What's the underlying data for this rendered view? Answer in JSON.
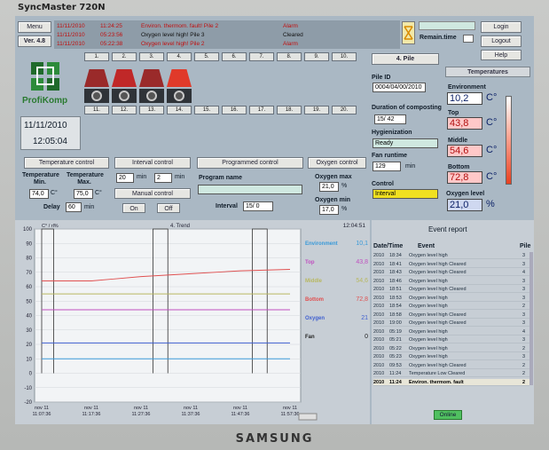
{
  "monitor": {
    "model": "SyncMaster 720N",
    "brand": "SAMSUNG"
  },
  "top": {
    "menu": "Menu",
    "version": "Ver. 4.8",
    "login": "Login",
    "logout": "Logout",
    "help": "Help",
    "remain_time": "Remain.time",
    "alarms": [
      {
        "date": "11/11/2010",
        "time": "11:24:25",
        "text": "Environ. thermom. fault! Pile 2",
        "status": "Alarm"
      },
      {
        "date": "11/11/2010",
        "time": "05:23:56",
        "text": "Oxygen level high! Pile 3",
        "status": "Cleared"
      },
      {
        "date": "11/11/2010",
        "time": "05:22:38",
        "text": "Oxygen level high! Pile 2",
        "status": "Alarm"
      }
    ]
  },
  "piles": {
    "top_numbers": [
      "1.",
      "2.",
      "3.",
      "4.",
      "5.",
      "6.",
      "7.",
      "8.",
      "9.",
      "10."
    ],
    "bottom_numbers": [
      "11.",
      "12.",
      "13.",
      "14.",
      "15.",
      "16.",
      "17.",
      "18.",
      "19.",
      "20."
    ],
    "selected": "4. Pile"
  },
  "logo": {
    "name": "ProfiKomp"
  },
  "clock": {
    "date": "11/11/2010",
    "time": "12:05:04"
  },
  "pile_info": {
    "pile_id_label": "Pile ID",
    "pile_id": "0004/04/00/2010",
    "duration_label": "Duration of composting",
    "duration": "15/  42",
    "hygienization_label": "Hygienization",
    "hygienization": "Ready",
    "fan_runtime_label": "Fan runtime",
    "fan_runtime": "129",
    "fan_runtime_unit": "min",
    "control_label": "Control",
    "control": "Interval"
  },
  "temperatures": {
    "title": "Temperatures",
    "environment_label": "Environment",
    "environment": "10,2",
    "top_label": "Top",
    "top": "43,8",
    "middle_label": "Middle",
    "middle": "54,6",
    "bottom_label": "Bottom",
    "bottom": "72,8",
    "unit": "C°",
    "oxygen_label": "Oxygen level",
    "oxygen": "21,0",
    "oxygen_unit": "%",
    "thermometer_colors": [
      "#ffffff",
      "#ffb0a0",
      "#e84020"
    ]
  },
  "controls": {
    "temperature_control": "Temperature control",
    "temp_min_label": "Temperature Min.",
    "temp_max_label": "Temperature Max.",
    "temp_min": "74,0",
    "temp_max": "75,0",
    "temp_unit": "C°",
    "delay_label": "Delay",
    "delay": "60",
    "delay_unit": "min",
    "interval_control": "Interval control",
    "interval_a": "20",
    "interval_b": "2",
    "interval_unit": "min",
    "manual_control": "Manual control",
    "on": "On",
    "off": "Off",
    "programmed_control": "Programmed control",
    "program_name_label": "Program name",
    "program_name": "",
    "interval_label": "Interval",
    "interval_value": "15/  0",
    "oxygen_control": "Oxygen control",
    "oxygen_max_label": "Oxygen max",
    "oxygen_max": "21,0",
    "oxygen_min_label": "Oxygen min",
    "oxygen_min": "17,0",
    "percent": "%"
  },
  "trend": {
    "title": "4. Trend",
    "unit_label": "C° / rl%",
    "time": "12:04:51",
    "y_ticks": [
      "100",
      "90",
      "80",
      "70",
      "60",
      "50",
      "40",
      "30",
      "20",
      "10",
      "0",
      "-10",
      "-20"
    ],
    "x_ticks": [
      {
        "date": "nov 11",
        "time": "11:07:36"
      },
      {
        "date": "nov 11",
        "time": "11:17:36"
      },
      {
        "date": "nov 11",
        "time": "11:27:36"
      },
      {
        "date": "nov 11",
        "time": "11:37:36"
      },
      {
        "date": "nov 11",
        "time": "11:47:36"
      },
      {
        "date": "nov 11",
        "time": "11:57:36"
      }
    ],
    "legend": [
      {
        "name": "Environment",
        "value": "10,1",
        "color": "#3a9ad8"
      },
      {
        "name": "Top",
        "value": "43,8",
        "color": "#c050c0"
      },
      {
        "name": "Middle",
        "value": "54,6",
        "color": "#b8b860"
      },
      {
        "name": "Bottom",
        "value": "72,8",
        "color": "#e05050"
      },
      {
        "name": "Oxygen",
        "value": "21",
        "color": "#4060d0"
      },
      {
        "name": "Fan",
        "value": "0",
        "color": "#222222"
      }
    ]
  },
  "chart_data": {
    "type": "line",
    "title": "4. Trend",
    "ylabel": "C° / rl%",
    "ylim": [
      -20,
      100
    ],
    "x": [
      "11:07:36",
      "11:17:36",
      "11:27:36",
      "11:37:36",
      "11:47:36",
      "11:57:36"
    ],
    "series": [
      {
        "name": "Environment",
        "values": [
          10,
          10,
          10,
          10,
          10,
          10
        ]
      },
      {
        "name": "Top",
        "values": [
          44,
          44,
          44,
          44,
          44,
          44
        ]
      },
      {
        "name": "Middle",
        "values": [
          55,
          55,
          55,
          55,
          55,
          55
        ]
      },
      {
        "name": "Bottom",
        "values": [
          64,
          64,
          67,
          69,
          71,
          72
        ]
      },
      {
        "name": "Oxygen",
        "values": [
          21,
          21,
          21,
          21,
          21,
          21
        ]
      }
    ],
    "fan_periods": [
      [
        "11:07:36",
        "11:10:00"
      ],
      [
        "11:30:00",
        "11:33:00"
      ],
      [
        "11:50:00",
        "11:53:00"
      ]
    ]
  },
  "events": {
    "title": "Event report",
    "col_date": "Date/Time",
    "col_event": "Event",
    "col_pile": "Pile",
    "rows": [
      {
        "date": "2010",
        "time": "18:34",
        "event": "Oxygen level high",
        "pile": "3"
      },
      {
        "date": "2010",
        "time": "18:41",
        "event": "Oxygen level high Cleared",
        "pile": "3"
      },
      {
        "date": "2010",
        "time": "18:43",
        "event": "Oxygen level high Cleared",
        "pile": "4"
      },
      {
        "date": "2010",
        "time": "18:46",
        "event": "Oxygen level high",
        "pile": "3"
      },
      {
        "date": "2010",
        "time": "18:51",
        "event": "Oxygen level high Cleared",
        "pile": "3"
      },
      {
        "date": "2010",
        "time": "18:53",
        "event": "Oxygen level high",
        "pile": "3"
      },
      {
        "date": "2010",
        "time": "18:54",
        "event": "Oxygen level high",
        "pile": "2"
      },
      {
        "date": "2010",
        "time": "18:58",
        "event": "Oxygen level high Cleared",
        "pile": "3"
      },
      {
        "date": "2010",
        "time": "19:00",
        "event": "Oxygen level high Cleared",
        "pile": "3"
      },
      {
        "date": "2010",
        "time": "05:19",
        "event": "Oxygen level high",
        "pile": "4"
      },
      {
        "date": "2010",
        "time": "05:21",
        "event": "Oxygen level high",
        "pile": "3"
      },
      {
        "date": "2010",
        "time": "05:22",
        "event": "Oxygen level high",
        "pile": "2"
      },
      {
        "date": "2010",
        "time": "05:23",
        "event": "Oxygen level high",
        "pile": "3"
      },
      {
        "date": "2010",
        "time": "09:53",
        "event": "Oxygen level high Cleared",
        "pile": "2"
      },
      {
        "date": "2010",
        "time": "11:24",
        "event": "Temperature Low Cleared",
        "pile": "2"
      },
      {
        "date": "2010",
        "time": "11:24",
        "event": "Environ. thermom. fault",
        "pile": "2"
      }
    ],
    "online": "Online"
  }
}
